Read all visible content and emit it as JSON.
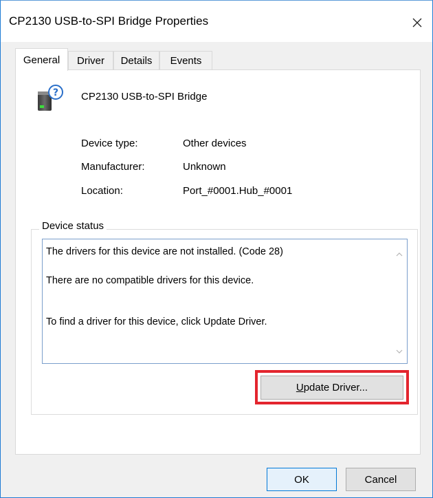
{
  "window": {
    "title": "CP2130 USB-to-SPI Bridge Properties"
  },
  "tabs": [
    {
      "label": "General"
    },
    {
      "label": "Driver"
    },
    {
      "label": "Details"
    },
    {
      "label": "Events"
    }
  ],
  "device": {
    "name": "CP2130 USB-to-SPI Bridge",
    "icon": "unknown-device-icon",
    "properties": [
      {
        "label": "Device type:",
        "value": "Other devices"
      },
      {
        "label": "Manufacturer:",
        "value": "Unknown"
      },
      {
        "label": "Location:",
        "value": "Port_#0001.Hub_#0001"
      }
    ]
  },
  "status": {
    "group_title": "Device status",
    "lines": [
      "The drivers for this device are not installed. (Code 28)",
      "There are no compatible drivers for this device.",
      "To find a driver for this device, click Update Driver."
    ]
  },
  "buttons": {
    "update_driver": "Update Driver...",
    "ok": "OK",
    "cancel": "Cancel"
  },
  "colors": {
    "highlight": "#e3252e",
    "window_border": "#1e7bd4"
  }
}
